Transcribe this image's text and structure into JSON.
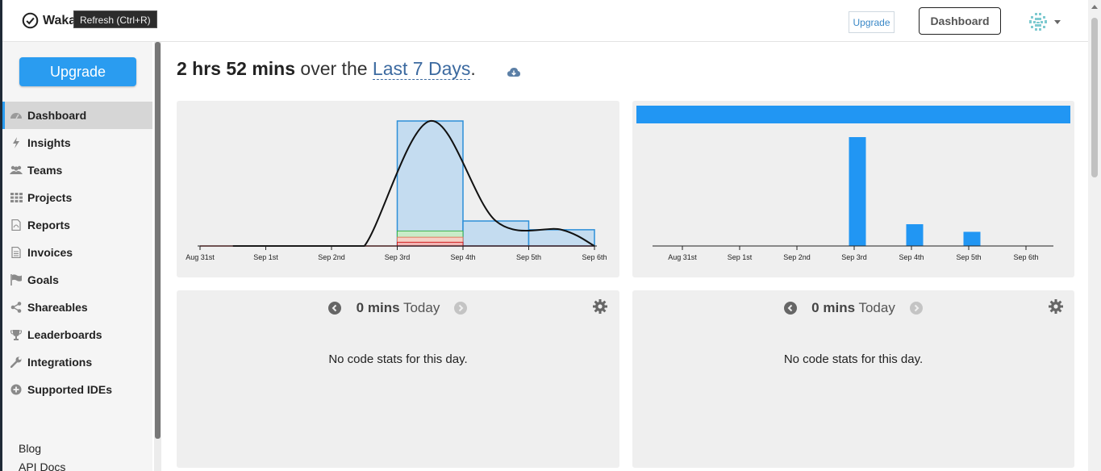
{
  "brand": {
    "name": "Waka"
  },
  "tooltip": "Refresh (Ctrl+R)",
  "topnav": {
    "upgrade_label": "Upgrade",
    "dashboard_label": "Dashboard"
  },
  "sidebar": {
    "upgrade_label": "Upgrade",
    "items": [
      {
        "label": "Dashboard",
        "icon": "dashboard-icon",
        "active": true
      },
      {
        "label": "Insights",
        "icon": "bolt-icon"
      },
      {
        "label": "Teams",
        "icon": "users-icon"
      },
      {
        "label": "Projects",
        "icon": "grid-icon"
      },
      {
        "label": "Reports",
        "icon": "pdf-file-icon"
      },
      {
        "label": "Invoices",
        "icon": "file-icon"
      },
      {
        "label": "Goals",
        "icon": "flag-icon"
      },
      {
        "label": "Shareables",
        "icon": "share-icon"
      },
      {
        "label": "Leaderboards",
        "icon": "trophy-icon"
      },
      {
        "label": "Integrations",
        "icon": "wrench-icon"
      },
      {
        "label": "Supported IDEs",
        "icon": "plus-circle-icon"
      }
    ],
    "links": [
      "Blog",
      "API Docs"
    ]
  },
  "headline": {
    "duration": "2 hrs 52 mins",
    "middle": " over the ",
    "range": "Last 7 Days",
    "end": "."
  },
  "colors": {
    "accent": "#2a9cf0",
    "bar": "#2196f3",
    "area": "#c4dcf0"
  },
  "chart_data": [
    {
      "type": "area",
      "categories": [
        "Aug 31st",
        "Sep 1st",
        "Sep 2nd",
        "Sep 3rd",
        "Sep 4th",
        "Sep 5th",
        "Sep 6th"
      ],
      "values": [
        0,
        0,
        0,
        1.0,
        0.2,
        0.13,
        0
      ],
      "secondary": {
        "green": 0.12,
        "salmon": 0.07,
        "red": 0.03
      },
      "grid": false
    },
    {
      "type": "bar",
      "categories": [
        "Aug 31st",
        "Sep 1st",
        "Sep 2nd",
        "Sep 3rd",
        "Sep 4th",
        "Sep 5th",
        "Sep 6th"
      ],
      "values": [
        0,
        0,
        0,
        1.0,
        0.2,
        0.13,
        0
      ],
      "legend_bar": true,
      "grid": false
    }
  ],
  "day_panels": [
    {
      "duration": "0 mins",
      "label": "Today",
      "empty_text": "No code stats for this day."
    },
    {
      "duration": "0 mins",
      "label": "Today",
      "empty_text": "No code stats for this day."
    }
  ]
}
